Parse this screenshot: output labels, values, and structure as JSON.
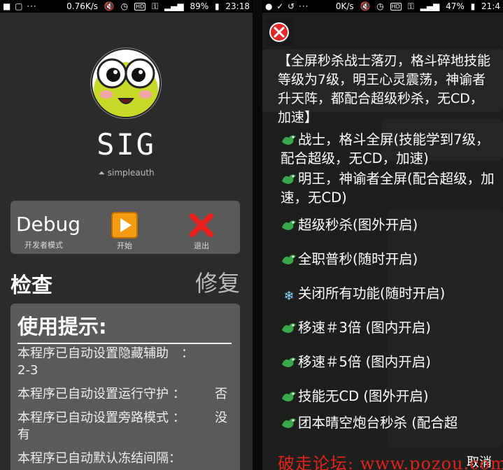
{
  "left_status": {
    "icons": "■ ▢ ···",
    "speed": "0.76K/s",
    "battery": "89%",
    "time": "23:18"
  },
  "right_status": {
    "speed": "0K/s",
    "battery": "47%",
    "time": "21:4"
  },
  "app": {
    "title": "SIG",
    "subtitle": "simpleauth",
    "toolbar": {
      "debug_label": "Debug",
      "debug_sub": "开发者模式",
      "start_label": "开始",
      "exit_label": "退出"
    },
    "check_label": "检查",
    "repair_label": "修复",
    "tips_title": "使用提示:",
    "tips": [
      {
        "text": "本程序已自动设置隐藏辅助　：",
        "value": "",
        "line2": "2-3"
      },
      {
        "text": " 本程序已自动设置运行守护 ：",
        "value": "否"
      },
      {
        "text": "本程序已自动设置旁路模式 ：",
        "value": "没",
        "line2": "有"
      },
      {
        "text": "本程序已自动默认冻结间隔：",
        "value": ""
      }
    ]
  },
  "dialog": {
    "intro": "【全屏秒杀战士落刃，格斗碎地技能等级为7级，明王心灵震荡，神谕者升天阵，都配合超级秒杀，无CD，加速】",
    "items": [
      "战士，格斗全屏(技能学到7级，配合超级，无CD，加速)",
      "明王，神谕者全屏(配合超级，加速，无CD)",
      "超级秒杀(图外开启)",
      "全职普秒(随时开启)",
      "关闭所有功能(随时开启)",
      "移速＃3倍 (图内开启)",
      "移速＃5倍 (图内开启)",
      "技能无CD (图外开启)",
      "团本晴空炮台秒杀 (配合超"
    ],
    "cancel_label": "取消"
  },
  "watermark": "破走论坛: www.pozou.com",
  "colors": {
    "left_bg": "#2b2b2b",
    "card_bg": "#5a5a5a",
    "dialog_bg": "#1d1f1d",
    "close_red": "#e02a2a",
    "watermark_red": "#e0231e"
  }
}
